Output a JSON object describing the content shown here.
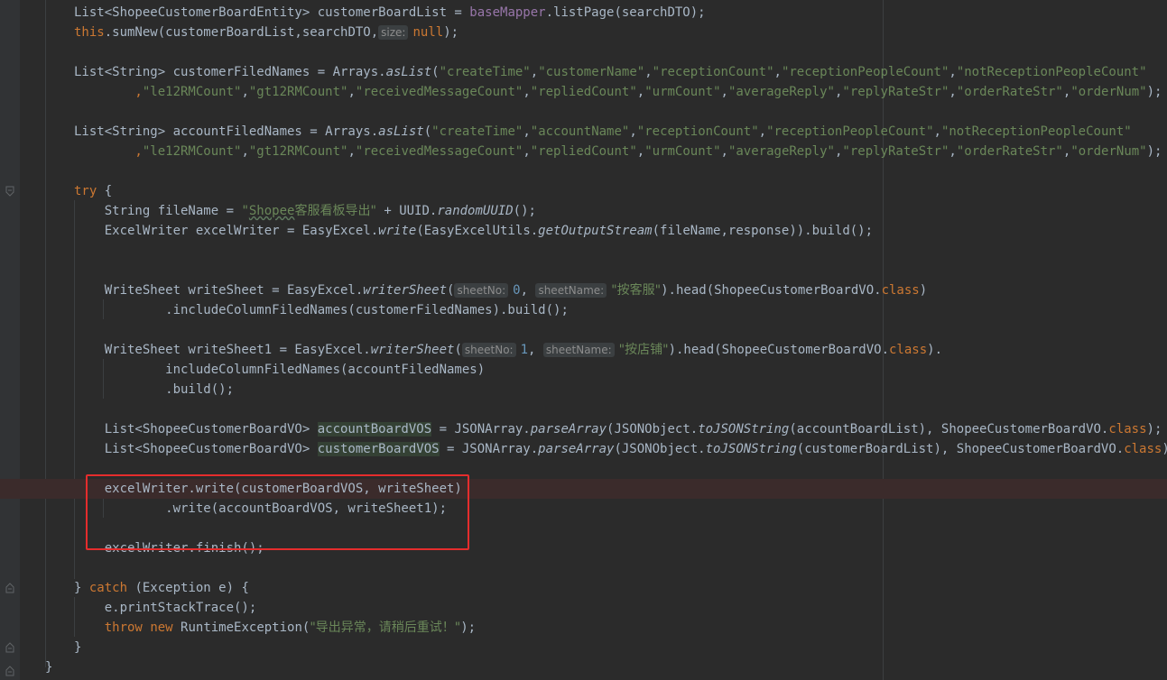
{
  "lines": [
    {
      "t": [
        [
          "List<ShopeeCustomerBoardEntity> customerBoardList = ",
          ""
        ],
        [
          "baseMapper",
          "field"
        ],
        [
          ".listPage(searchDTO);",
          ""
        ]
      ]
    },
    {
      "t": [
        [
          "this",
          "kw"
        ],
        [
          ".sumNew(customerBoardList,searchDTO,",
          ""
        ],
        [
          "size:",
          "hint"
        ],
        [
          "null",
          "kw"
        ],
        [
          ");",
          ""
        ]
      ]
    },
    {
      "t": []
    },
    {
      "t": [
        [
          "List<String> customerFiledNames = Arrays.",
          ""
        ],
        [
          "asList",
          "meth-it"
        ],
        [
          "(",
          ""
        ],
        [
          "\"createTime\"",
          "str"
        ],
        [
          ",",
          ""
        ],
        [
          "\"customerName\"",
          "str"
        ],
        [
          ",",
          ""
        ],
        [
          "\"receptionCount\"",
          "str"
        ],
        [
          ",",
          ""
        ],
        [
          "\"receptionPeopleCount\"",
          "str"
        ],
        [
          ",",
          ""
        ],
        [
          "\"notReceptionPeopleCount\"",
          "str"
        ]
      ]
    },
    {
      "t": [
        [
          "        ,",
          "kw"
        ],
        [
          "\"le12RMCount\"",
          "str"
        ],
        [
          ",",
          ""
        ],
        [
          "\"gt12RMCount\"",
          "str"
        ],
        [
          ",",
          ""
        ],
        [
          "\"receivedMessageCount\"",
          "str"
        ],
        [
          ",",
          ""
        ],
        [
          "\"repliedCount\"",
          "str"
        ],
        [
          ",",
          ""
        ],
        [
          "\"urmCount\"",
          "str"
        ],
        [
          ",",
          ""
        ],
        [
          "\"averageReply\"",
          "str"
        ],
        [
          ",",
          ""
        ],
        [
          "\"replyRateStr\"",
          "str"
        ],
        [
          ",",
          ""
        ],
        [
          "\"orderRateStr\"",
          "str"
        ],
        [
          ",",
          ""
        ],
        [
          "\"orderNum\"",
          "str"
        ],
        [
          ");",
          ""
        ]
      ]
    },
    {
      "t": []
    },
    {
      "t": [
        [
          "List<String> accountFiledNames = Arrays.",
          ""
        ],
        [
          "asList",
          "meth-it"
        ],
        [
          "(",
          ""
        ],
        [
          "\"createTime\"",
          "str"
        ],
        [
          ",",
          ""
        ],
        [
          "\"accountName\"",
          "str"
        ],
        [
          ",",
          ""
        ],
        [
          "\"receptionCount\"",
          "str"
        ],
        [
          ",",
          ""
        ],
        [
          "\"receptionPeopleCount\"",
          "str"
        ],
        [
          ",",
          ""
        ],
        [
          "\"notReceptionPeopleCount\"",
          "str"
        ]
      ]
    },
    {
      "t": [
        [
          "        ,",
          "kw"
        ],
        [
          "\"le12RMCount\"",
          "str"
        ],
        [
          ",",
          ""
        ],
        [
          "\"gt12RMCount\"",
          "str"
        ],
        [
          ",",
          ""
        ],
        [
          "\"receivedMessageCount\"",
          "str"
        ],
        [
          ",",
          ""
        ],
        [
          "\"repliedCount\"",
          "str"
        ],
        [
          ",",
          ""
        ],
        [
          "\"urmCount\"",
          "str"
        ],
        [
          ",",
          ""
        ],
        [
          "\"averageReply\"",
          "str"
        ],
        [
          ",",
          ""
        ],
        [
          "\"replyRateStr\"",
          "str"
        ],
        [
          ",",
          ""
        ],
        [
          "\"orderRateStr\"",
          "str"
        ],
        [
          ",",
          ""
        ],
        [
          "\"orderNum\"",
          "str"
        ],
        [
          ");",
          ""
        ]
      ]
    },
    {
      "t": []
    },
    {
      "t": [
        [
          "try",
          "kw"
        ],
        [
          " {",
          ""
        ]
      ]
    },
    {
      "t": [
        [
          "    String fileName = ",
          ""
        ],
        [
          "\"",
          "str"
        ],
        [
          "Shopee",
          "str typo"
        ],
        [
          "客服看板导出\"",
          "str cn"
        ],
        [
          " + UUID.",
          ""
        ],
        [
          "randomUUID",
          "meth-it"
        ],
        [
          "();",
          ""
        ]
      ]
    },
    {
      "t": [
        [
          "    ExcelWriter excelWriter = EasyExcel.",
          ""
        ],
        [
          "write",
          "meth-it"
        ],
        [
          "(EasyExcelUtils.",
          ""
        ],
        [
          "getOutputStream",
          "meth-it"
        ],
        [
          "(fileName,response)).build();",
          ""
        ]
      ]
    },
    {
      "t": []
    },
    {
      "t": []
    },
    {
      "t": [
        [
          "    WriteSheet writeSheet = EasyExcel.",
          ""
        ],
        [
          "writerSheet",
          "meth-it"
        ],
        [
          "(",
          ""
        ],
        [
          "sheetNo:",
          "hint"
        ],
        [
          "0",
          "num"
        ],
        [
          ", ",
          ""
        ],
        [
          "sheetName:",
          "hint"
        ],
        [
          "\"按客服\"",
          "str cn"
        ],
        [
          ").head(ShopeeCustomerBoardVO.",
          ""
        ],
        [
          "class",
          "kw"
        ],
        [
          ")",
          ""
        ]
      ]
    },
    {
      "t": [
        [
          "            .includeColumnFiledNames(customerFiledNames).build();",
          ""
        ]
      ]
    },
    {
      "t": []
    },
    {
      "t": [
        [
          "    WriteSheet writeSheet1 = EasyExcel.",
          ""
        ],
        [
          "writerSheet",
          "meth-it"
        ],
        [
          "(",
          ""
        ],
        [
          "sheetNo:",
          "hint"
        ],
        [
          "1",
          "num"
        ],
        [
          ", ",
          ""
        ],
        [
          "sheetName:",
          "hint"
        ],
        [
          "\"按店铺\"",
          "str cn"
        ],
        [
          ").head(ShopeeCustomerBoardVO.",
          ""
        ],
        [
          "class",
          "kw"
        ],
        [
          ").",
          ""
        ]
      ]
    },
    {
      "t": [
        [
          "            includeColumnFiledNames(accountFiledNames)",
          ""
        ]
      ]
    },
    {
      "t": [
        [
          "            .build();",
          ""
        ]
      ]
    },
    {
      "t": []
    },
    {
      "t": [
        [
          "    List<ShopeeCustomerBoardVO> ",
          ""
        ],
        [
          "accountBoardVOS",
          "hl"
        ],
        [
          " = JSONArray.",
          ""
        ],
        [
          "parseArray",
          "meth-it"
        ],
        [
          "(JSONObject.",
          ""
        ],
        [
          "toJSONString",
          "meth-it"
        ],
        [
          "(accountBoardList), ShopeeCustomerBoardVO.",
          ""
        ],
        [
          "class",
          "kw"
        ],
        [
          ");",
          ""
        ]
      ]
    },
    {
      "t": [
        [
          "    List<ShopeeCustomerBoardVO> ",
          ""
        ],
        [
          "customerBoardVOS",
          "hl"
        ],
        [
          " = JSONArray.",
          ""
        ],
        [
          "parseArray",
          "meth-it"
        ],
        [
          "(JSONObject.",
          ""
        ],
        [
          "toJSONString",
          "meth-it"
        ],
        [
          "(customerBoardList), ShopeeCustomerBoardVO.",
          ""
        ],
        [
          "class",
          "kw"
        ],
        [
          ");",
          ""
        ]
      ]
    },
    {
      "t": []
    },
    {
      "t": [
        [
          "    excelWriter.write(customerBoardVOS, writeSheet)",
          ""
        ]
      ],
      "err": true
    },
    {
      "t": [
        [
          "            .write(accountBoardVOS, writeSheet1);",
          ""
        ]
      ]
    },
    {
      "t": []
    },
    {
      "t": [
        [
          "    excelWriter.finish();",
          ""
        ]
      ]
    },
    {
      "t": []
    },
    {
      "t": [
        [
          "} ",
          ""
        ],
        [
          "catch",
          "kw"
        ],
        [
          " (Exception e) {",
          ""
        ]
      ]
    },
    {
      "t": [
        [
          "    e.printStackTrace();",
          ""
        ]
      ]
    },
    {
      "t": [
        [
          "    ",
          "",
          ""
        ],
        [
          "throw",
          "kw"
        ],
        [
          " ",
          ""
        ],
        [
          "new",
          "kw"
        ],
        [
          " RuntimeException(",
          ""
        ],
        [
          "\"导出异常，请稍后重试！\"",
          "str cn"
        ],
        [
          ");",
          ""
        ]
      ]
    },
    {
      "t": [
        [
          "}",
          ""
        ]
      ]
    },
    {
      "t": [
        [
          "}",
          ""
        ]
      ],
      "outer": true
    }
  ]
}
